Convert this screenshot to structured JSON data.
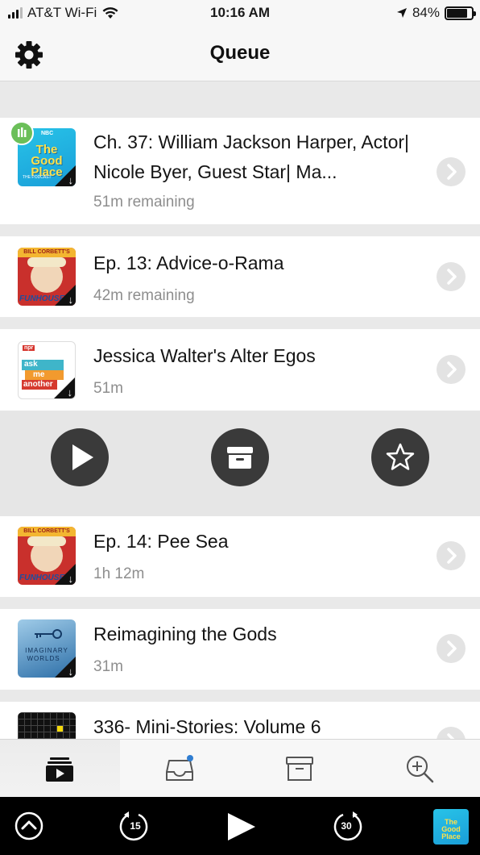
{
  "status_bar": {
    "carrier": "AT&T Wi-Fi",
    "time": "10:16 AM",
    "battery_percent": "84%",
    "battery_level": 0.84
  },
  "nav": {
    "title": "Queue",
    "settings_icon": "gear-icon"
  },
  "queue": [
    {
      "title": "Ch. 37: William Jackson Harper, Actor| Nicole Byer, Guest Star| Ma...",
      "subtitle": "51m remaining",
      "art": "the-good-place",
      "art_label_top": "NBC",
      "art_label_main": "The Good Place",
      "art_label_bottom": "THE PODCAST",
      "now_playing": true,
      "downloaded": true
    },
    {
      "title": "Ep. 13: Advice-o-Rama",
      "subtitle": "42m remaining",
      "art": "bill-corbetts-funhouse",
      "art_label_top": "BILL CORBETT'S",
      "art_label_bottom": "FUNHOUSE",
      "downloaded": true
    },
    {
      "title": "Jessica Walter's Alter Egos",
      "subtitle": "51m",
      "art": "ask-me-another",
      "art_label_top": "npr",
      "art_words": [
        "ask",
        "me",
        "another"
      ],
      "downloaded": true
    },
    {
      "title": "Ep. 14: Pee Sea",
      "subtitle": "1h 12m",
      "art": "bill-corbetts-funhouse",
      "art_label_top": "BILL CORBETT'S",
      "art_label_bottom": "FUNHOUSE",
      "downloaded": true
    },
    {
      "title": "Reimagining the Gods",
      "subtitle": "31m",
      "art": "imaginary-worlds",
      "art_label_main": "IMAGINARY",
      "art_label_bottom": "WORLDS",
      "downloaded": true
    },
    {
      "title": "336- Mini-Stories: Volume 6",
      "subtitle": "",
      "art": "99-percent-invisible"
    }
  ],
  "actions": {
    "play_icon": "play-icon",
    "archive_icon": "archive-icon",
    "star_icon": "star-icon"
  },
  "tabs": [
    {
      "id": "queue",
      "icon": "queue-icon",
      "active": true
    },
    {
      "id": "inbox",
      "icon": "inbox-icon",
      "badge": true
    },
    {
      "id": "archive",
      "icon": "archive-box-icon"
    },
    {
      "id": "search",
      "icon": "search-plus-icon"
    }
  ],
  "player": {
    "skip_back_seconds": "15",
    "skip_forward_seconds": "30",
    "mini_art_label": "The Good Place",
    "colors": {
      "background": "#000000",
      "icon": "#ffffff"
    }
  },
  "colors": {
    "separator": "#e9e9e9",
    "tray": "#e6e6e6",
    "action_button": "#3a3a3a",
    "now_playing_badge": "#6bbf59",
    "subtitle": "#8e8e8e"
  }
}
